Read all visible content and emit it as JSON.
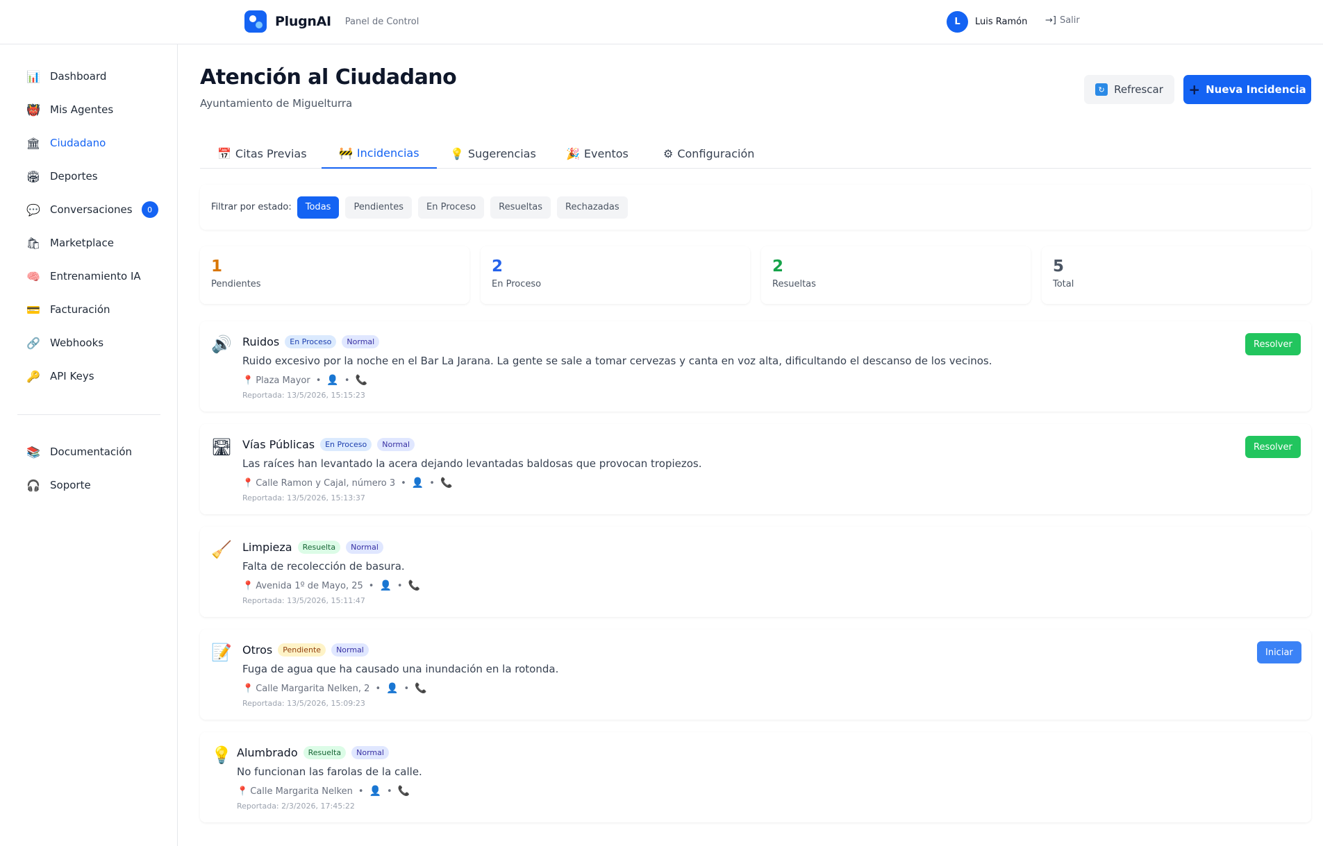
{
  "header": {
    "brand": "PlugnAI",
    "subtitle": "Panel de Control",
    "user_initial": "L",
    "user_name": "Luis Ramón",
    "logout_label": "Salir"
  },
  "sidebar": {
    "items": [
      {
        "label": "Dashboard",
        "icon": "chart-icon"
      },
      {
        "label": "Mis Agentes",
        "icon": "agent-icon"
      },
      {
        "label": "Ciudadano",
        "icon": "building-icon"
      },
      {
        "label": "Deportes",
        "icon": "stadium-icon"
      },
      {
        "label": "Conversaciones",
        "icon": "chat-icon",
        "badge": "0"
      },
      {
        "label": "Marketplace",
        "icon": "store-icon"
      },
      {
        "label": "Entrenamiento IA",
        "icon": "brain-icon"
      },
      {
        "label": "Facturación",
        "icon": "card-icon"
      },
      {
        "label": "Webhooks",
        "icon": "link-icon"
      },
      {
        "label": "API Keys",
        "icon": "key-icon"
      }
    ],
    "footer_items": [
      {
        "label": "Documentación",
        "icon": "books-icon"
      },
      {
        "label": "Soporte",
        "icon": "headphones-icon"
      }
    ]
  },
  "page": {
    "title": "Atención al Ciudadano",
    "subtitle": "Ayuntamiento de Miguelturra",
    "refresh_label": "Refrescar",
    "new_label": "Nueva Incidencia"
  },
  "tabs": [
    {
      "label": "Citas Previas",
      "icon": "calendar-icon"
    },
    {
      "label": "Incidencias",
      "icon": "barrier-icon"
    },
    {
      "label": "Sugerencias",
      "icon": "lightbulb-icon"
    },
    {
      "label": "Eventos",
      "icon": "party-icon"
    },
    {
      "label": "Configuración",
      "icon": "gear-icon"
    }
  ],
  "filter": {
    "label": "Filtrar por estado:",
    "options": [
      "Todas",
      "Pendientes",
      "En Proceso",
      "Resueltas",
      "Rechazadas"
    ],
    "selected": "Todas"
  },
  "stats": [
    {
      "value": "1",
      "label": "Pendientes",
      "color": "#d97706"
    },
    {
      "value": "2",
      "label": "En Proceso",
      "color": "#2563eb"
    },
    {
      "value": "2",
      "label": "Resueltas",
      "color": "#16a34a"
    },
    {
      "value": "5",
      "label": "Total",
      "color": "#4b5563"
    }
  ],
  "incidents": [
    {
      "category": "Ruidos",
      "icon": "speaker-icon",
      "status": "En Proceso",
      "priority": "Normal",
      "description": "Ruido excesivo por la noche en el Bar La Jarana. La gente se sale a tomar cervezas y canta en voz alta, dificultando el descanso de los vecinos.",
      "location": "Plaza Mayor",
      "date": "Reportada: 13/5/2026, 15:15:23",
      "action": "Resolver"
    },
    {
      "category": "Vías Públicas",
      "icon": "road-icon",
      "status": "En Proceso",
      "priority": "Normal",
      "description": "Las raíces han levantado la acera dejando levantadas baldosas que provocan tropiezos.",
      "location": "Calle Ramon y Cajal, número 3",
      "date": "Reportada: 13/5/2026, 15:13:37",
      "action": "Resolver"
    },
    {
      "category": "Limpieza",
      "icon": "broom-icon",
      "status": "Resuelta",
      "priority": "Normal",
      "description": "Falta de recolección de basura.",
      "location": "Avenida 1º de Mayo, 25",
      "date": "Reportada: 13/5/2026, 15:11:47",
      "action": ""
    },
    {
      "category": "Otros",
      "icon": "memo-icon",
      "status": "Pendiente",
      "priority": "Normal",
      "description": "Fuga de agua que ha causado una inundación en la rotonda.",
      "location": "Calle Margarita Nelken, 2",
      "date": "Reportada: 13/5/2026, 15:09:23",
      "action": "Iniciar"
    },
    {
      "category": "Alumbrado",
      "icon": "lightbulb-icon",
      "status": "Resuelta",
      "priority": "Normal",
      "description": "No funcionan las farolas de la calle.",
      "location": "Calle Margarita Nelken",
      "date": "Reportada: 2/3/2026, 17:45:22",
      "action": ""
    }
  ]
}
